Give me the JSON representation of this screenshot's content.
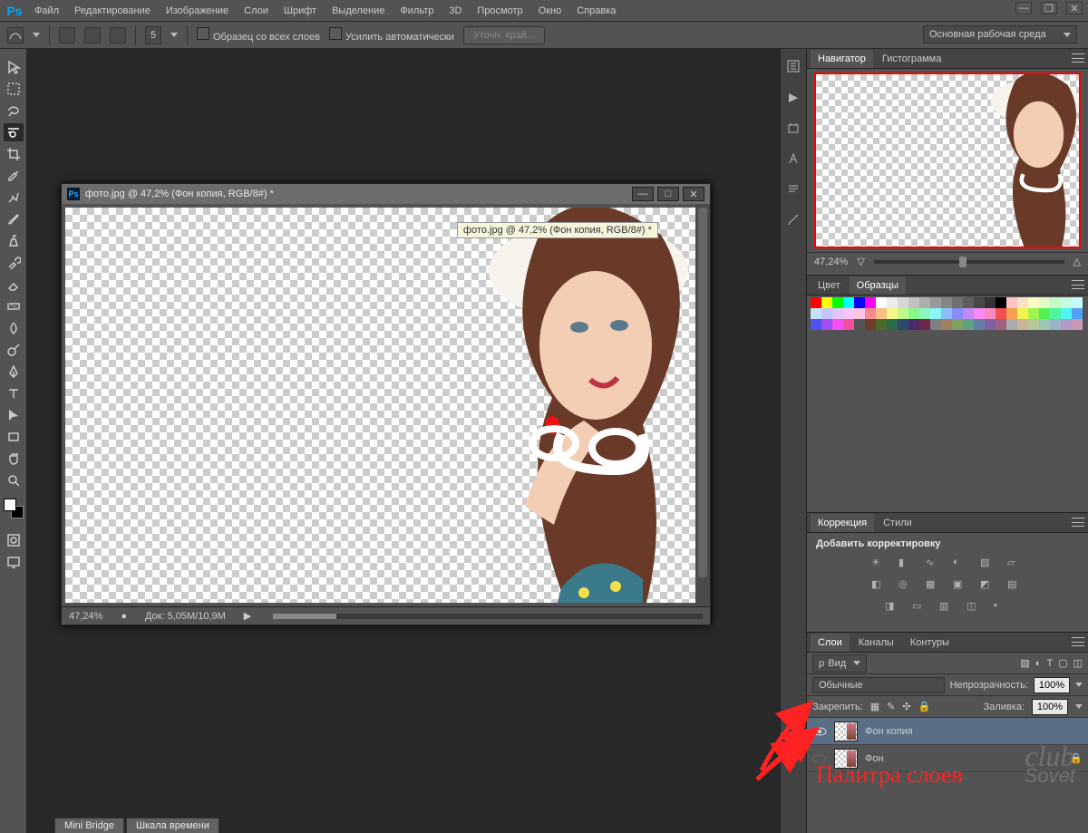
{
  "menu": [
    "Файл",
    "Редактирование",
    "Изображение",
    "Слои",
    "Шрифт",
    "Выделение",
    "Фильтр",
    "3D",
    "Просмотр",
    "Окно",
    "Справка"
  ],
  "options": {
    "size": "5",
    "cb1": "Образец со всех слоев",
    "cb2": "Усилить автоматически",
    "btn": "Уточн. край..."
  },
  "workspace": "Основная рабочая среда",
  "doc": {
    "title": "фото.jpg @ 47,2% (Фон копия, RGB/8#) *",
    "tip": "фото.jpg @ 47,2% (Фон копия, RGB/8#) *",
    "zoom": "47,24%",
    "size": "Док: 5,05M/10,9M"
  },
  "panels": {
    "navigator": {
      "tab1": "Навигатор",
      "tab2": "Гистограмма",
      "zoom": "47,24%"
    },
    "color": {
      "tab1": "Цвет",
      "tab2": "Образцы"
    },
    "adjust": {
      "tab1": "Коррекция",
      "tab2": "Стили",
      "label": "Добавить корректировку"
    },
    "layers": {
      "tab1": "Слои",
      "tab2": "Каналы",
      "tab3": "Контуры",
      "kind": "Вид",
      "mode": "Обычные",
      "opacity_label": "Непрозрачность:",
      "opacity": "100%",
      "lock": "Закрепить:",
      "fill_label": "Заливка:",
      "fill": "100%",
      "items": [
        {
          "name": "Фон копия",
          "locked": false
        },
        {
          "name": "Фон",
          "locked": true
        }
      ]
    }
  },
  "bottom": {
    "tab1": "Mini Bridge",
    "tab2": "Шкала времени"
  },
  "annotation": "Палитра слоев",
  "swatches": [
    "#ff0000",
    "#ffff00",
    "#00ff00",
    "#00ffff",
    "#0000ff",
    "#ff00ff",
    "#ffffff",
    "#ebebeb",
    "#d6d6d6",
    "#c2c2c2",
    "#adadad",
    "#999999",
    "#858585",
    "#707070",
    "#5c5c5c",
    "#474747",
    "#333333",
    "#000000",
    "#fbc5c5",
    "#fbe1c5",
    "#fbfbc5",
    "#e1fbc5",
    "#c5fbc5",
    "#c5fbe1",
    "#c5fbfb",
    "#c5e1fb",
    "#c5c5fb",
    "#e1c5fb",
    "#fbc5fb",
    "#fbc5e1",
    "#f78a8a",
    "#f7c08a",
    "#f7f78a",
    "#c0f78a",
    "#8af78a",
    "#8af7c0",
    "#8af7f7",
    "#8ac0f7",
    "#8a8af7",
    "#c08af7",
    "#f78af7",
    "#f78ac0",
    "#f35050",
    "#f3a050",
    "#f3f350",
    "#a0f350",
    "#50f350",
    "#50f3a0",
    "#50f3f3",
    "#50a0f3",
    "#5050f3",
    "#a050f3",
    "#f350f3",
    "#f350a0",
    "#555555",
    "#6b3f2a",
    "#4b6b2a",
    "#2a6b4b",
    "#2a4b6b",
    "#4b2a6b",
    "#6b2a4b",
    "#808080",
    "#a08060",
    "#80a060",
    "#60a080",
    "#6080a0",
    "#8060a0",
    "#a06080",
    "#ababab",
    "#c8b498",
    "#b4c898",
    "#98c8b4",
    "#98b4c8",
    "#b498c8",
    "#c898b4"
  ]
}
